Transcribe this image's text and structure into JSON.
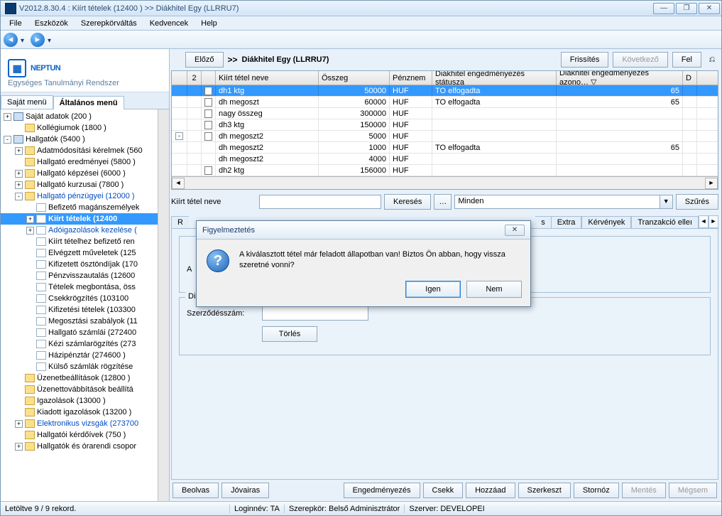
{
  "window": {
    "title": "V2012.8.30.4 : Kiírt tételek (12400  ) >> Diákhitel Egy (LLRRU7)",
    "min": "—",
    "max": "❐",
    "close": "✕"
  },
  "menubar": [
    "File",
    "Eszközök",
    "Szerepkörváltás",
    "Kedvencek",
    "Help"
  ],
  "logo": {
    "brand": "NEPTUN",
    "sub": "Egységes Tanulmányi Rendszer"
  },
  "left_tabs": {
    "a": "Saját menü",
    "b": "Általános menü"
  },
  "tree": [
    {
      "ind": 0,
      "exp": "+",
      "icon": "group",
      "label": "Saját adatok (200  )",
      "cls": ""
    },
    {
      "ind": 1,
      "exp": "",
      "icon": "folder",
      "label": "Kollégiumok (1800  )",
      "cls": ""
    },
    {
      "ind": 0,
      "exp": "-",
      "icon": "group",
      "label": "Hallgatók (5400  )",
      "cls": ""
    },
    {
      "ind": 1,
      "exp": "+",
      "icon": "folder",
      "label": "Adatmódosítási kérelmek (560",
      "cls": ""
    },
    {
      "ind": 1,
      "exp": "",
      "icon": "folder",
      "label": "Hallgató eredményei (5800  )",
      "cls": ""
    },
    {
      "ind": 1,
      "exp": "+",
      "icon": "folder",
      "label": "Hallgató képzései (6000  )",
      "cls": ""
    },
    {
      "ind": 1,
      "exp": "+",
      "icon": "folder",
      "label": "Hallgató kurzusai (7800  )",
      "cls": ""
    },
    {
      "ind": 1,
      "exp": "-",
      "icon": "folder",
      "label": "Hallgató pénzügyei (12000  )",
      "cls": "blue"
    },
    {
      "ind": 2,
      "exp": "",
      "icon": "file",
      "label": "Befizető magánszemélyek",
      "cls": ""
    },
    {
      "ind": 2,
      "exp": "+",
      "icon": "file",
      "label": "Kiírt tételek (12400",
      "cls": "sel"
    },
    {
      "ind": 2,
      "exp": "+",
      "icon": "file",
      "label": "Adóigazolások kezelése (",
      "cls": "blue"
    },
    {
      "ind": 2,
      "exp": "",
      "icon": "file",
      "label": "Kiírt tételhez befizető ren",
      "cls": ""
    },
    {
      "ind": 2,
      "exp": "",
      "icon": "file",
      "label": "Elvégzett műveletek (125",
      "cls": ""
    },
    {
      "ind": 2,
      "exp": "",
      "icon": "file",
      "label": "Kifizetett ösztöndíjak (170",
      "cls": ""
    },
    {
      "ind": 2,
      "exp": "",
      "icon": "file",
      "label": "Pénzvisszautalás (12600",
      "cls": ""
    },
    {
      "ind": 2,
      "exp": "",
      "icon": "file",
      "label": "Tételek megbontása, öss",
      "cls": ""
    },
    {
      "ind": 2,
      "exp": "",
      "icon": "file",
      "label": "Csekkrögzítés (103100",
      "cls": ""
    },
    {
      "ind": 2,
      "exp": "",
      "icon": "file",
      "label": "Kifizetési tételek (103300",
      "cls": ""
    },
    {
      "ind": 2,
      "exp": "",
      "icon": "file",
      "label": "Megosztási szabályok (11",
      "cls": ""
    },
    {
      "ind": 2,
      "exp": "",
      "icon": "file",
      "label": "Hallgató számlái (272400",
      "cls": ""
    },
    {
      "ind": 2,
      "exp": "",
      "icon": "file",
      "label": "Kézi számlarögzítés (273",
      "cls": ""
    },
    {
      "ind": 2,
      "exp": "",
      "icon": "file",
      "label": "Házipénztár (274600  )",
      "cls": ""
    },
    {
      "ind": 2,
      "exp": "",
      "icon": "file",
      "label": "Külső számlák rögzítése",
      "cls": ""
    },
    {
      "ind": 1,
      "exp": "",
      "icon": "folder",
      "label": "Üzenetbeállítások (12800  )",
      "cls": ""
    },
    {
      "ind": 1,
      "exp": "",
      "icon": "folder",
      "label": "Üzenettovábbítások beállítá",
      "cls": ""
    },
    {
      "ind": 1,
      "exp": "",
      "icon": "folder",
      "label": "Igazolások (13000  )",
      "cls": ""
    },
    {
      "ind": 1,
      "exp": "",
      "icon": "folder",
      "label": "Kiadott igazolások (13200  )",
      "cls": ""
    },
    {
      "ind": 1,
      "exp": "+",
      "icon": "folder",
      "label": "Elektronikus vizsgák (273700",
      "cls": "blue"
    },
    {
      "ind": 1,
      "exp": "",
      "icon": "folder",
      "label": "Hallgatói kérdőívek (750  )",
      "cls": ""
    },
    {
      "ind": 1,
      "exp": "+",
      "icon": "folder",
      "label": "Hallgatók és órarendi csopor",
      "cls": ""
    }
  ],
  "right_top": {
    "prev": "Előző",
    "path_arrow": ">>",
    "path_text": "Diákhitel Egy (LLRRU7)",
    "refresh": "Frissítés",
    "next": "Következő",
    "up": "Fel",
    "pin": "⎌"
  },
  "grid": {
    "idx": "2",
    "cols": [
      "Kiírt tétel neve",
      "Összeg",
      "Pénznem",
      "Diákhitel engedményezés státusza",
      "Diákhitel engedményezés azono…  ▽",
      "D"
    ],
    "rows": [
      {
        "exp": "",
        "chk": true,
        "name": "dh1 ktg",
        "amt": "50000",
        "cur": "HUF",
        "stat": "TO elfogadta",
        "id2": "65",
        "d": ""
      },
      {
        "exp": "",
        "chk": false,
        "name": "dh megoszt",
        "amt": "60000",
        "cur": "HUF",
        "stat": "TO elfogadta",
        "id2": "65",
        "d": ""
      },
      {
        "exp": "",
        "chk": false,
        "name": "nagy összeg",
        "amt": "300000",
        "cur": "HUF",
        "stat": "",
        "id2": "",
        "d": ""
      },
      {
        "exp": "",
        "chk": false,
        "name": "dh3 ktg",
        "amt": "150000",
        "cur": "HUF",
        "stat": "",
        "id2": "",
        "d": ""
      },
      {
        "exp": "-",
        "chk": false,
        "name": "dh megoszt2",
        "amt": "5000",
        "cur": "HUF",
        "stat": "",
        "id2": "",
        "d": ""
      },
      {
        "exp": " ",
        "chk": "",
        "name": "dh megoszt2",
        "amt": "1000",
        "cur": "HUF",
        "stat": "TO elfogadta",
        "id2": "65",
        "d": ""
      },
      {
        "exp": " ",
        "chk": "",
        "name": "dh megoszt2",
        "amt": "4000",
        "cur": "HUF",
        "stat": "",
        "id2": "",
        "d": ""
      },
      {
        "exp": "",
        "chk": false,
        "name": "dh2 ktg",
        "amt": "156000",
        "cur": "HUF",
        "stat": "",
        "id2": "",
        "d": ""
      }
    ]
  },
  "search": {
    "label": "Kiírt tétel neve",
    "value": "",
    "btn_search": "Keresés",
    "btn_more": "…",
    "combo": "Minden",
    "btn_filter": "Szűrés"
  },
  "detail_tabs": {
    "left_partial": "R",
    "gap_partial": "s",
    "items": [
      "Extra",
      "Kérvények",
      "Tranzakció elleı"
    ]
  },
  "group2": {
    "title": "Diákhitel 2",
    "fld_label": "Szerződésszám:",
    "fld_value": "",
    "btn_delete": "Törlés"
  },
  "bottom": {
    "beolvas": "Beolvas",
    "jovairas": "Jóvairas",
    "enged": "Engedményezés",
    "csekk": "Csekk",
    "hozzaad": "Hozzáad",
    "szerk": "Szerkeszt",
    "storno": "Stornóz",
    "mentes": "Mentés",
    "megsem": "Mégsem"
  },
  "status": {
    "left": "Letöltve 9 / 9 rekord.",
    "login": "Loginnév: TA",
    "role": "Szerepkör: Belső Adminisztrátor",
    "server": "Szerver: DEVELOPEI"
  },
  "modal": {
    "title": "Figyelmeztetés",
    "close": "✕",
    "icon": "?",
    "msg": "A kiválasztott tétel már feladott állapotban van! Biztos Ön abban, hogy vissza szeretné vonni?",
    "yes": "Igen",
    "no": "Nem"
  }
}
